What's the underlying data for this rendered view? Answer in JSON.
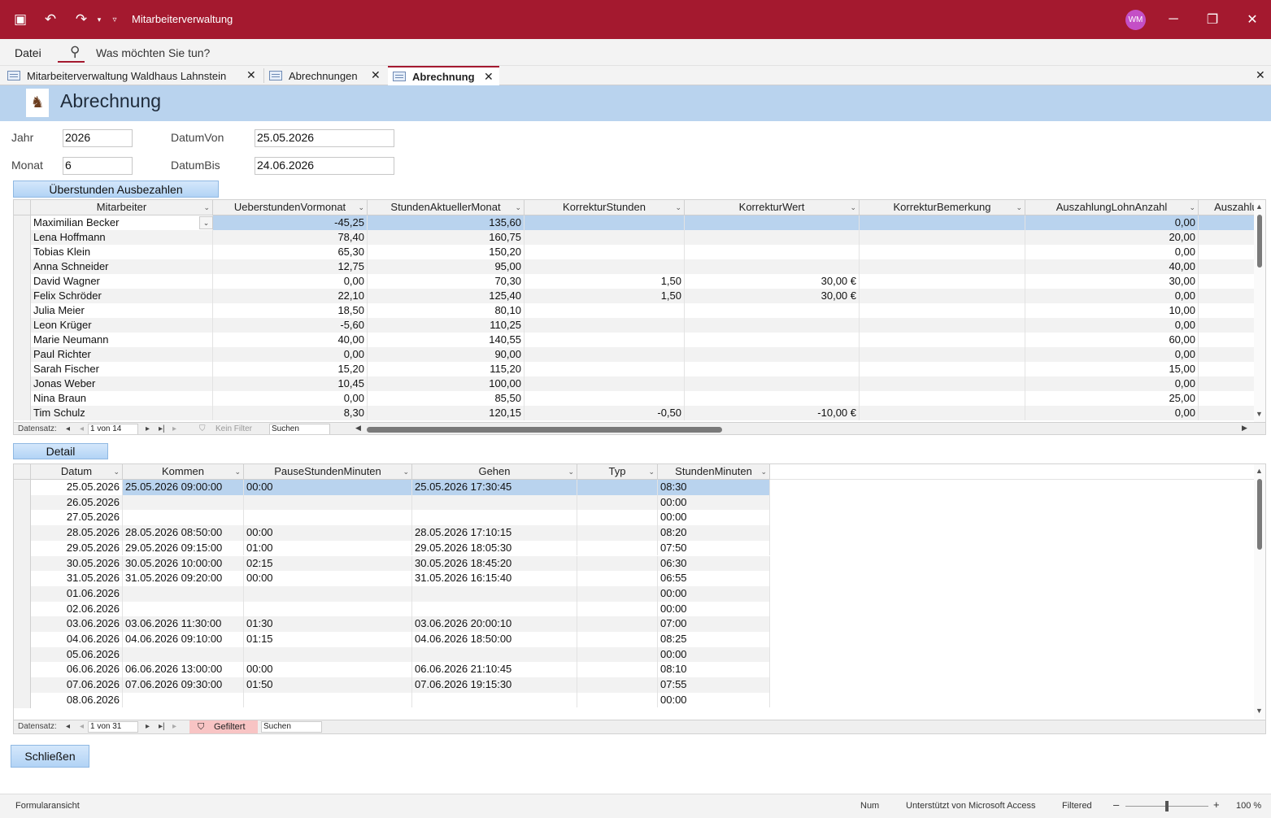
{
  "app": {
    "title": "Mitarbeiterverwaltung",
    "avatar": "WM"
  },
  "menu": {
    "file": "Datei",
    "search_placeholder": "Was möchten Sie tun?"
  },
  "tabs": [
    {
      "label": "Mitarbeiterverwaltung Waldhaus Lahnstein"
    },
    {
      "label": "Abrechnungen"
    },
    {
      "label": "Abrechnung"
    }
  ],
  "form": {
    "title": "Abrechnung",
    "jahr_label": "Jahr",
    "jahr_value": "2026",
    "monat_label": "Monat",
    "monat_value": "6",
    "datumvon_label": "DatumVon",
    "datumvon_value": "25.05.2026",
    "datumbis_label": "DatumBis",
    "datumbis_value": "24.06.2026",
    "btn_ueberstunden": "Überstunden Ausbezahlen",
    "btn_detail": "Detail",
    "btn_close": "Schließen"
  },
  "grid1": {
    "columns": [
      "Mitarbeiter",
      "UeberstundenVormonat",
      "StundenAktuellerMonat",
      "KorrekturStunden",
      "KorrekturWert",
      "KorrekturBemerkung",
      "AuszahlungLohnAnzahl",
      "Auszahlun"
    ],
    "rows": [
      [
        "Maximilian Becker",
        "-45,25",
        "135,60",
        "",
        "",
        "",
        "0,00",
        ""
      ],
      [
        "Lena Hoffmann",
        "78,40",
        "160,75",
        "",
        "",
        "",
        "20,00",
        ""
      ],
      [
        "Tobias Klein",
        "65,30",
        "150,20",
        "",
        "",
        "",
        "0,00",
        ""
      ],
      [
        "Anna Schneider",
        "12,75",
        "95,00",
        "",
        "",
        "",
        "40,00",
        ""
      ],
      [
        "David Wagner",
        "0,00",
        "70,30",
        "1,50",
        "30,00 €",
        "",
        "30,00",
        ""
      ],
      [
        "Felix Schröder",
        "22,10",
        "125,40",
        "1,50",
        "30,00 €",
        "",
        "0,00",
        ""
      ],
      [
        "Julia Meier",
        "18,50",
        "80,10",
        "",
        "",
        "",
        "10,00",
        ""
      ],
      [
        "Leon Krüger",
        "-5,60",
        "110,25",
        "",
        "",
        "",
        "0,00",
        ""
      ],
      [
        "Marie Neumann",
        "40,00",
        "140,55",
        "",
        "",
        "",
        "60,00",
        ""
      ],
      [
        "Paul Richter",
        "0,00",
        "90,00",
        "",
        "",
        "",
        "0,00",
        ""
      ],
      [
        "Sarah Fischer",
        "15,20",
        "115,20",
        "",
        "",
        "",
        "15,00",
        ""
      ],
      [
        "Jonas Weber",
        "10,45",
        "100,00",
        "",
        "",
        "",
        "0,00",
        ""
      ],
      [
        "Nina Braun",
        "0,00",
        "85,50",
        "",
        "",
        "",
        "25,00",
        ""
      ],
      [
        "Tim Schulz",
        "8,30",
        "120,15",
        "-0,50",
        "-10,00 €",
        "",
        "0,00",
        ""
      ]
    ],
    "nav": {
      "label": "Datensatz:",
      "position": "1 von 14",
      "filter": "Kein Filter",
      "search": "Suchen"
    }
  },
  "grid2": {
    "columns": [
      "Datum",
      "Kommen",
      "PauseStundenMinuten",
      "Gehen",
      "Typ",
      "StundenMinuten"
    ],
    "rows": [
      [
        "25.05.2026",
        "25.05.2026 09:00:00",
        "00:00",
        "25.05.2026 17:30:45",
        "",
        "08:30"
      ],
      [
        "26.05.2026",
        "",
        "",
        "",
        "",
        "00:00"
      ],
      [
        "27.05.2026",
        "",
        "",
        "",
        "",
        "00:00"
      ],
      [
        "28.05.2026",
        "28.05.2026 08:50:00",
        "00:00",
        "28.05.2026 17:10:15",
        "",
        "08:20"
      ],
      [
        "29.05.2026",
        "29.05.2026 09:15:00",
        "01:00",
        "29.05.2026 18:05:30",
        "",
        "07:50"
      ],
      [
        "30.05.2026",
        "30.05.2026 10:00:00",
        "02:15",
        "30.05.2026 18:45:20",
        "",
        "06:30"
      ],
      [
        "31.05.2026",
        "31.05.2026 09:20:00",
        "00:00",
        "31.05.2026 16:15:40",
        "",
        "06:55"
      ],
      [
        "01.06.2026",
        "",
        "",
        "",
        "",
        "00:00"
      ],
      [
        "02.06.2026",
        "",
        "",
        "",
        "",
        "00:00"
      ],
      [
        "03.06.2026",
        "03.06.2026 11:30:00",
        "01:30",
        "03.06.2026 20:00:10",
        "",
        "07:00"
      ],
      [
        "04.06.2026",
        "04.06.2026 09:10:00",
        "01:15",
        "04.06.2026 18:50:00",
        "",
        "08:25"
      ],
      [
        "05.06.2026",
        "",
        "",
        "",
        "",
        "00:00"
      ],
      [
        "06.06.2026",
        "06.06.2026 13:00:00",
        "00:00",
        "06.06.2026 21:10:45",
        "",
        "08:10"
      ],
      [
        "07.06.2026",
        "07.06.2026 09:30:00",
        "01:50",
        "07.06.2026 19:15:30",
        "",
        "07:55"
      ],
      [
        "08.06.2026",
        "",
        "",
        "",
        "",
        "00:00"
      ]
    ],
    "nav": {
      "label": "Datensatz:",
      "position": "1 von 31",
      "filter": "Gefiltert",
      "search": "Suchen"
    }
  },
  "status": {
    "view": "Formularansicht",
    "num": "Num",
    "powered": "Unterstützt von Microsoft Access",
    "filtered": "Filtered",
    "zoom_minus": "–",
    "zoom_plus": "+",
    "zoom": "100 %"
  },
  "colors": {
    "titlebar": "#a4192f",
    "header": "#b9d3ee",
    "selection": "#b9d3ee",
    "filter": "#f8c4c4"
  }
}
